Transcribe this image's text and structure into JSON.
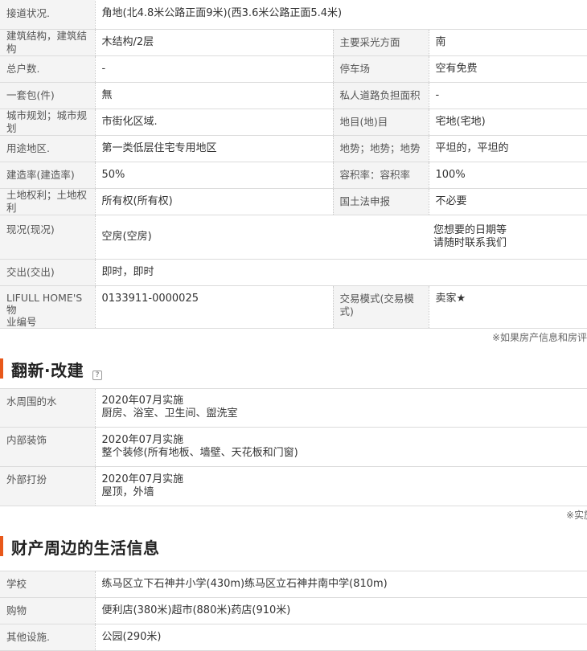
{
  "property_details": {
    "rows": [
      {
        "label": "接道状况.",
        "value": "角地(北4.8米公路正面9米)(西3.6米公路正面5.4米)"
      },
      {
        "label": "建筑结构，建筑结构",
        "value": "木结构/2层",
        "label2": "主要采光方面",
        "value2": "南"
      },
      {
        "label": "总户数.",
        "value": "-",
        "label2": "停车场",
        "value2": "空有免费"
      },
      {
        "label": "一套包(件)",
        "value": "無",
        "label2": "私人道路负担面积",
        "value2": "-"
      },
      {
        "label": "城市规划；城市规划",
        "value": "市街化区域.",
        "label2": "地目(地)目",
        "value2": "宅地(宅地)"
      },
      {
        "label": "用途地区.",
        "value": "第一类低层住宅专用地区",
        "label2": "地势；地势；地势",
        "value2": "平坦的，平坦的"
      },
      {
        "label": "建造率(建造率)",
        "value": "50%",
        "label2": "容积率：容积率",
        "value2": "100%"
      },
      {
        "label": "土地权利；土地权利",
        "value": "所有权(所有权)",
        "label2": "国土法申报",
        "value2": "不必要"
      }
    ],
    "status": {
      "label": "现况(现况)",
      "value": "空房(空房)",
      "contact_line1": "您想要的日期等",
      "contact_line2": "请随时联系我们"
    },
    "delivery": {
      "label": "交出(交出)",
      "value": "即时，即时"
    },
    "id_row": {
      "label_line1": "LIFULL HOME'S物",
      "label_line2": "业编号",
      "value": "0133911-0000025",
      "label2": "交易模式(交易模式)",
      "value2": "卖家★"
    },
    "note": "※如果房产信息和房评"
  },
  "reform": {
    "title": "翻新·改建",
    "help_icon": "?",
    "rows": [
      {
        "label": "水周围的水",
        "date": "2020年07月实施",
        "detail": "厨房、浴室、卫生间、盥洗室"
      },
      {
        "label": "内部装饰",
        "date": "2020年07月实施",
        "detail": "整个装修(所有地板、墙壁、天花板和门窗)"
      },
      {
        "label": "外部打扮",
        "date": "2020年07月实施",
        "detail": "屋顶，外墙"
      }
    ],
    "note": "※实施"
  },
  "life": {
    "title": "财产周边的生活信息",
    "rows": [
      {
        "label": "学校",
        "value": "练马区立下石神井小学(430m)练马区立石神井南中学(810m)"
      },
      {
        "label": "购物",
        "value": "便利店(380米)超市(880米)药店(910米)"
      },
      {
        "label": "其他设施.",
        "value": "公园(290米)"
      }
    ]
  },
  "colors": {
    "accent": "#e8581a",
    "header_bg": "#f4f4f4",
    "border": "#dcdcdc",
    "button": "#1a6fd1"
  }
}
